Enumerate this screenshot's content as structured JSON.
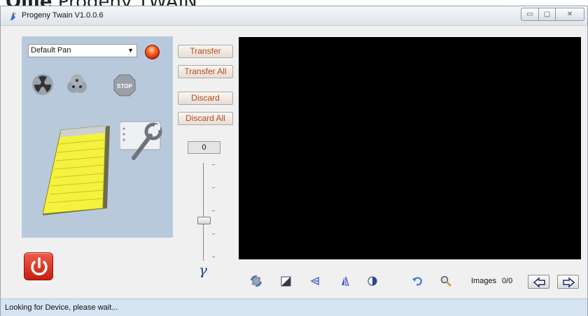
{
  "caption": {
    "bold": "Ollie",
    "text": "Progeny TWAIN"
  },
  "window": {
    "title": "Progeny Twain V1.0.0.6",
    "min_glyph": "▭",
    "max_glyph": "▢",
    "close_glyph": "✕"
  },
  "scanner": {
    "pan_selected": "Default Pan"
  },
  "actions": {
    "transfer": "Transfer",
    "transfer_all": "Transfer All",
    "discard": "Discard",
    "discard_all": "Discard All"
  },
  "gamma": {
    "value": "0",
    "symbol": "γ",
    "level": 0.38
  },
  "images": {
    "label": "Images",
    "count": "0/0"
  },
  "status": {
    "text": "Looking for Device, please wait..."
  },
  "colors": {
    "panel": "#b9c9dc",
    "preview": "#000000",
    "button_text": "#b54a22",
    "status_bar": "#d6e3f1"
  }
}
